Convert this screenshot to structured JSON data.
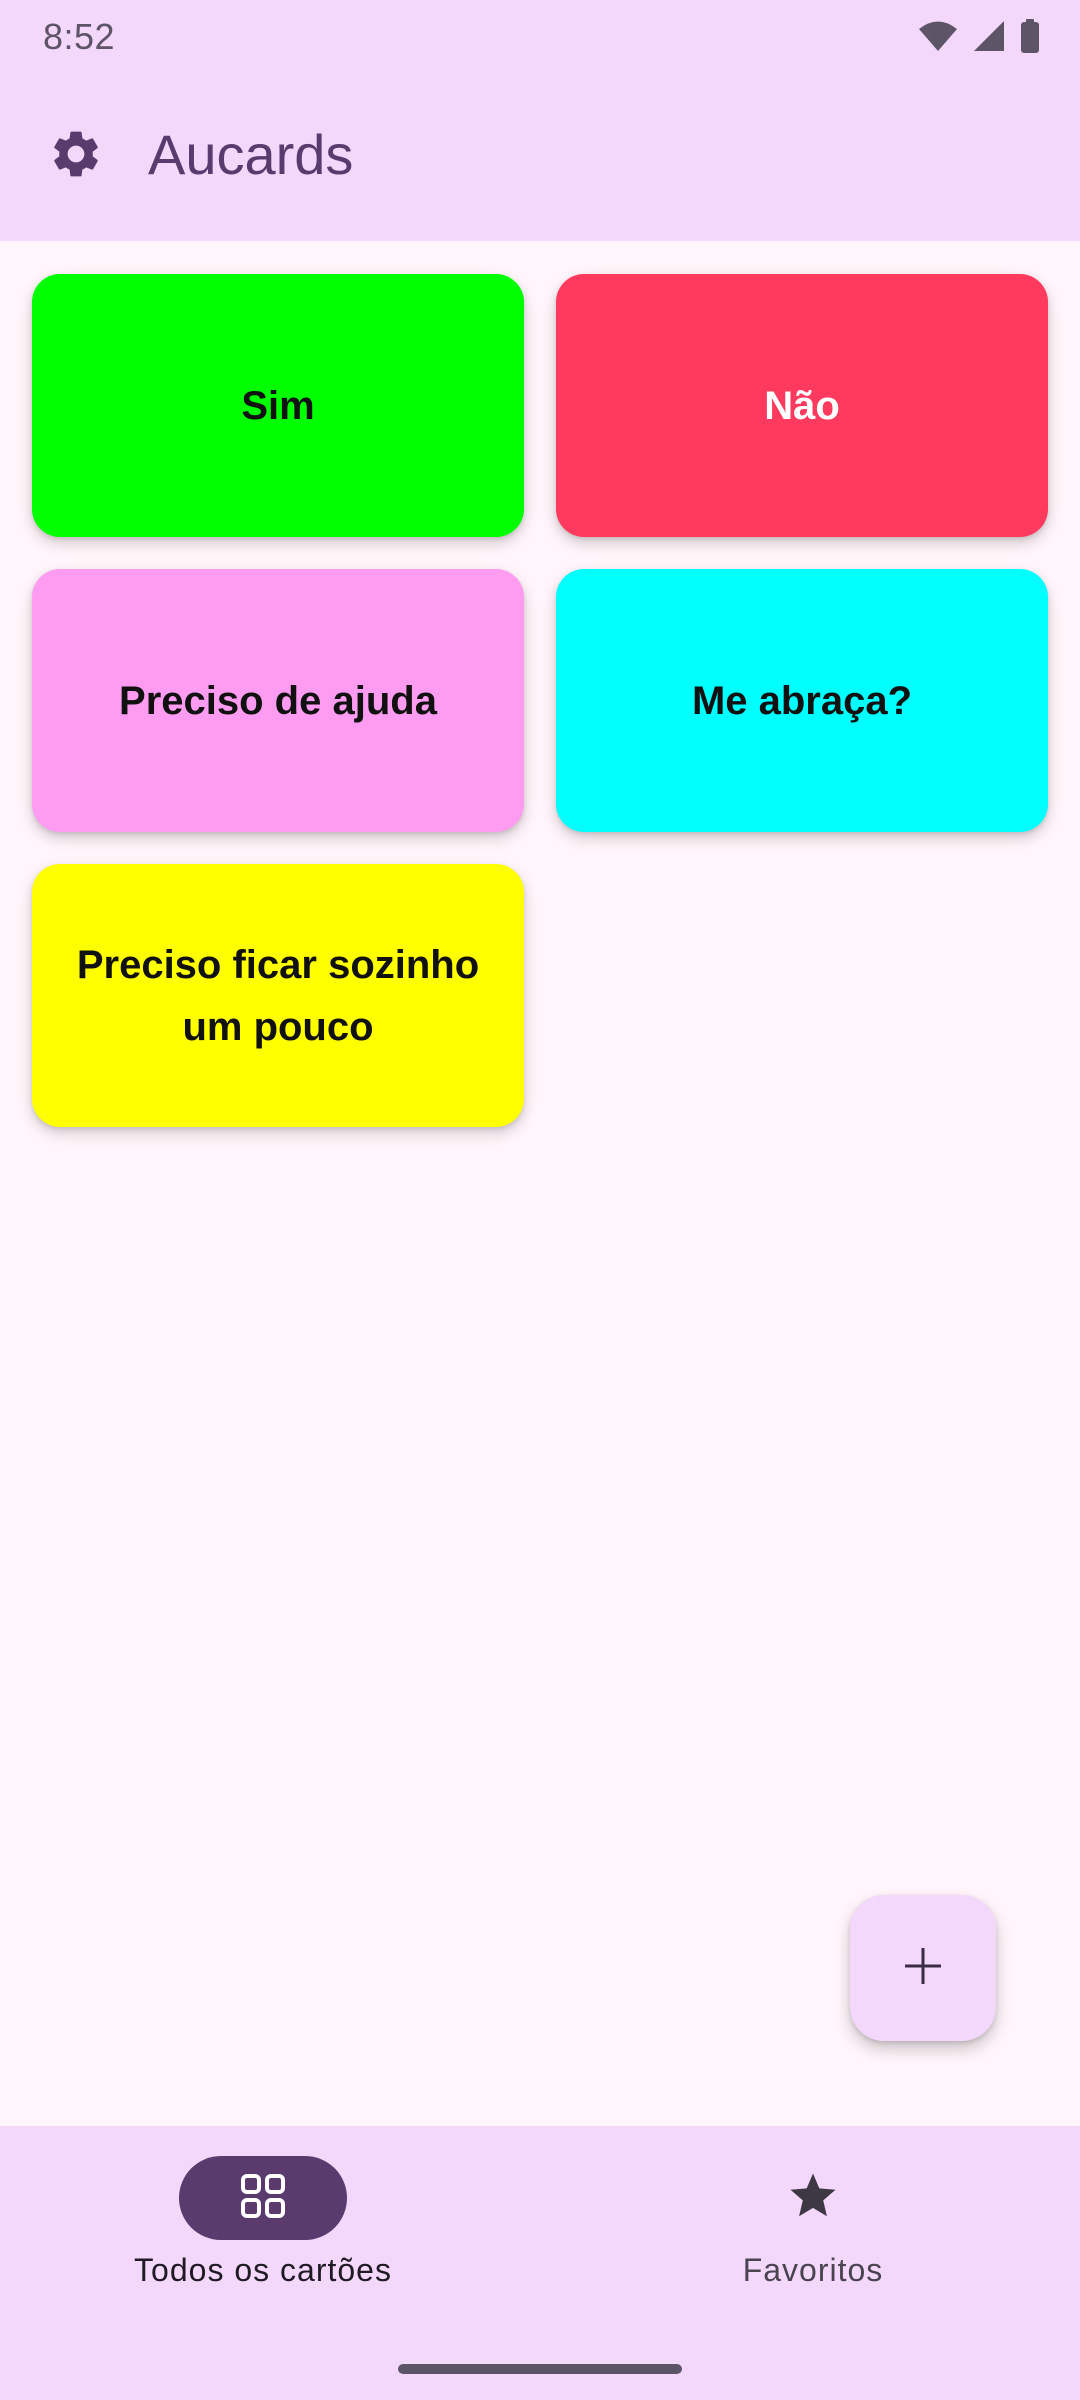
{
  "status_bar": {
    "time": "8:52",
    "icons": [
      "wifi-icon",
      "signal-icon",
      "battery-icon"
    ]
  },
  "app_bar": {
    "title": "Aucards",
    "settings_icon": "gear-icon"
  },
  "cards": [
    {
      "label": "Sim",
      "color": "#00FF00",
      "text_color": "#111111"
    },
    {
      "label": "Não",
      "color": "#FF3A5E",
      "text_color": "#FFFFFF"
    },
    {
      "label": "Preciso de ajuda",
      "color": "#FF9CF2",
      "text_color": "#111111"
    },
    {
      "label": "Me abraça?",
      "color": "#00FFFF",
      "text_color": "#111111"
    },
    {
      "label": "Preciso ficar sozinho um pouco",
      "color": "#FFFF00",
      "text_color": "#111111"
    }
  ],
  "fab": {
    "icon": "plus-icon"
  },
  "bottom_nav": {
    "items": [
      {
        "label": "Todos os cartões",
        "icon": "grid-icon",
        "selected": true
      },
      {
        "label": "Favoritos",
        "icon": "star-icon",
        "selected": false
      }
    ]
  },
  "colors": {
    "primary": "#5B3A6E",
    "surface_tint": "#F3D8FC",
    "background": "#FFF5FA"
  }
}
